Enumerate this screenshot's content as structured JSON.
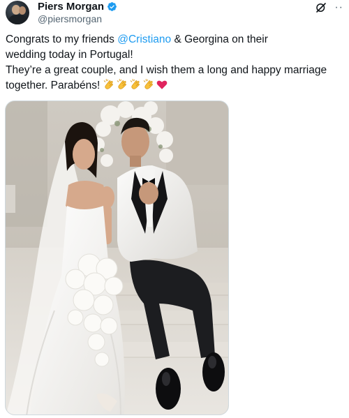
{
  "tweet": {
    "author": {
      "display_name": "Piers Morgan",
      "handle": "@piersmorgan",
      "verified": true
    },
    "text": {
      "line1_before": "Congrats to my friends ",
      "mention": "@Cristiano",
      "line1_after": " & Georgina on their",
      "line2": "wedding today in Portugal!",
      "line3": "They’re a great couple, and I wish them a long and happy marriage",
      "line4": "together. Parabéns!"
    },
    "emojis": [
      "clapping-hands",
      "clapping-hands",
      "clapping-hands",
      "clapping-hands",
      "red-heart"
    ],
    "colors": {
      "mention": "#1d9bf0",
      "verified_badge": "#1d9bf0",
      "secondary_text": "#536471",
      "heart": "#e0245e"
    },
    "icons": {
      "grok": "grok-icon",
      "more": "more-icon"
    }
  }
}
